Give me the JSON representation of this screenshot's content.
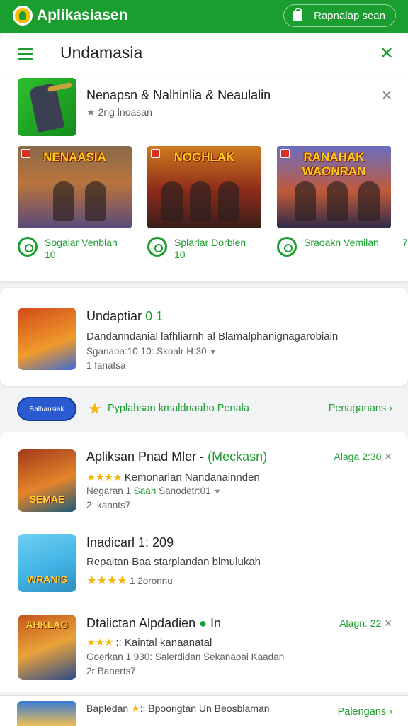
{
  "topbar": {
    "brand": "Aplikasiasen",
    "action": "Rapnalap sean"
  },
  "header": {
    "title": "Undamasia"
  },
  "featured": {
    "title": "Nenapsn & Nalhinlia & Neaulalin",
    "subtitle": "2ng lnoasan",
    "screenshots": [
      {
        "label": "NENAASIA",
        "caption1": "Sogalar Venblan",
        "caption2": "10"
      },
      {
        "label": "NOGHLAK",
        "caption1": "Splarlar Dorblen",
        "caption2": "10"
      },
      {
        "label": "RANAHAK WAONRAN",
        "caption1": "Sraoakn Vemilan",
        "caption2": ""
      }
    ],
    "more_caption": "7"
  },
  "app1": {
    "title": "Undaptiar",
    "badge": "0 1",
    "line": "Dandanndanial lafhliarnh al Blamalphanignagarobiain",
    "meta": "Sganaoa:10 10: Skoalr H:30",
    "meta2": "1 fanatsa"
  },
  "promo": {
    "pill": "Balhansiak",
    "text": "Pyplahsan kmaldnaaho Penala",
    "link": "Penaganans"
  },
  "app2": {
    "title": "Apliksan Pnad Mler - ",
    "title_green": "(Meckasn)",
    "right": "Alaga 2:30",
    "stars": "★★★★",
    "line": "Kemonarlan Nandanainnden",
    "meta": "Negaran 1 ",
    "meta_green": "Saah",
    "meta_rest": " Sanodetr:01",
    "meta2": "2: kannts7",
    "icon_word": "SEMAE"
  },
  "app3": {
    "title": "Inadicarl 1: 209",
    "line": "Repaitan Baa starplandan blmulukah",
    "stars": "★★★★",
    "meta": "1 2oronnu",
    "icon_word": "WRANIS"
  },
  "app4": {
    "title": "Dtalictan Alpdadien",
    "badge": "In",
    "right": "Alagn: 22",
    "stars": "★★★",
    "line": ":: Kaintal kanaanatal",
    "meta": "Goerkan 1 930: Salerdidan Sekanaoai Kaadan",
    "meta2": "2r Banerts7",
    "icon_word": "AHKLAG"
  },
  "bottom": {
    "text": "Bapledan",
    "text2": ":: Bpoorigtan Un Beosblaman",
    "link": "Palengans"
  }
}
